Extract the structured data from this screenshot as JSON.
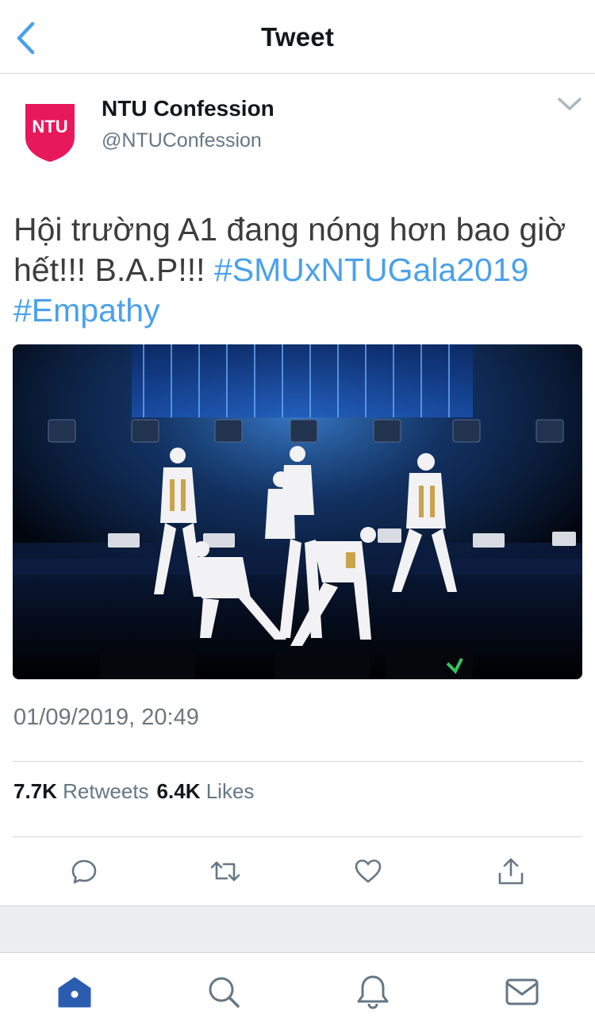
{
  "nav": {
    "title": "Tweet"
  },
  "author": {
    "display_name": "NTU Confession",
    "handle": "@NTUConfession",
    "avatar_text": "NTU",
    "avatar_color": "#e8185d"
  },
  "tweet": {
    "text_part1": "Hội trường A1 đang nóng hơn bao giờ hết!!! B.A.P!!! ",
    "hashtag1": "#SMUxNTUGala2019",
    "hashtag2": "#Empathy",
    "timestamp": "01/09/2019, 20:49"
  },
  "stats": {
    "retweets_count": "7.7K",
    "retweets_label": "Retweets",
    "likes_count": "6.4K",
    "likes_label": "Likes"
  },
  "actions": [
    "reply-icon",
    "retweet-icon",
    "like-icon",
    "share-icon"
  ],
  "tabbar": [
    "home-icon",
    "search-icon",
    "notifications-icon",
    "messages-icon"
  ],
  "colors": {
    "accent": "#1da1f2",
    "hashtag": "#4aa1eb",
    "tab_active": "#2a5db0",
    "icon_gray": "#657786"
  }
}
